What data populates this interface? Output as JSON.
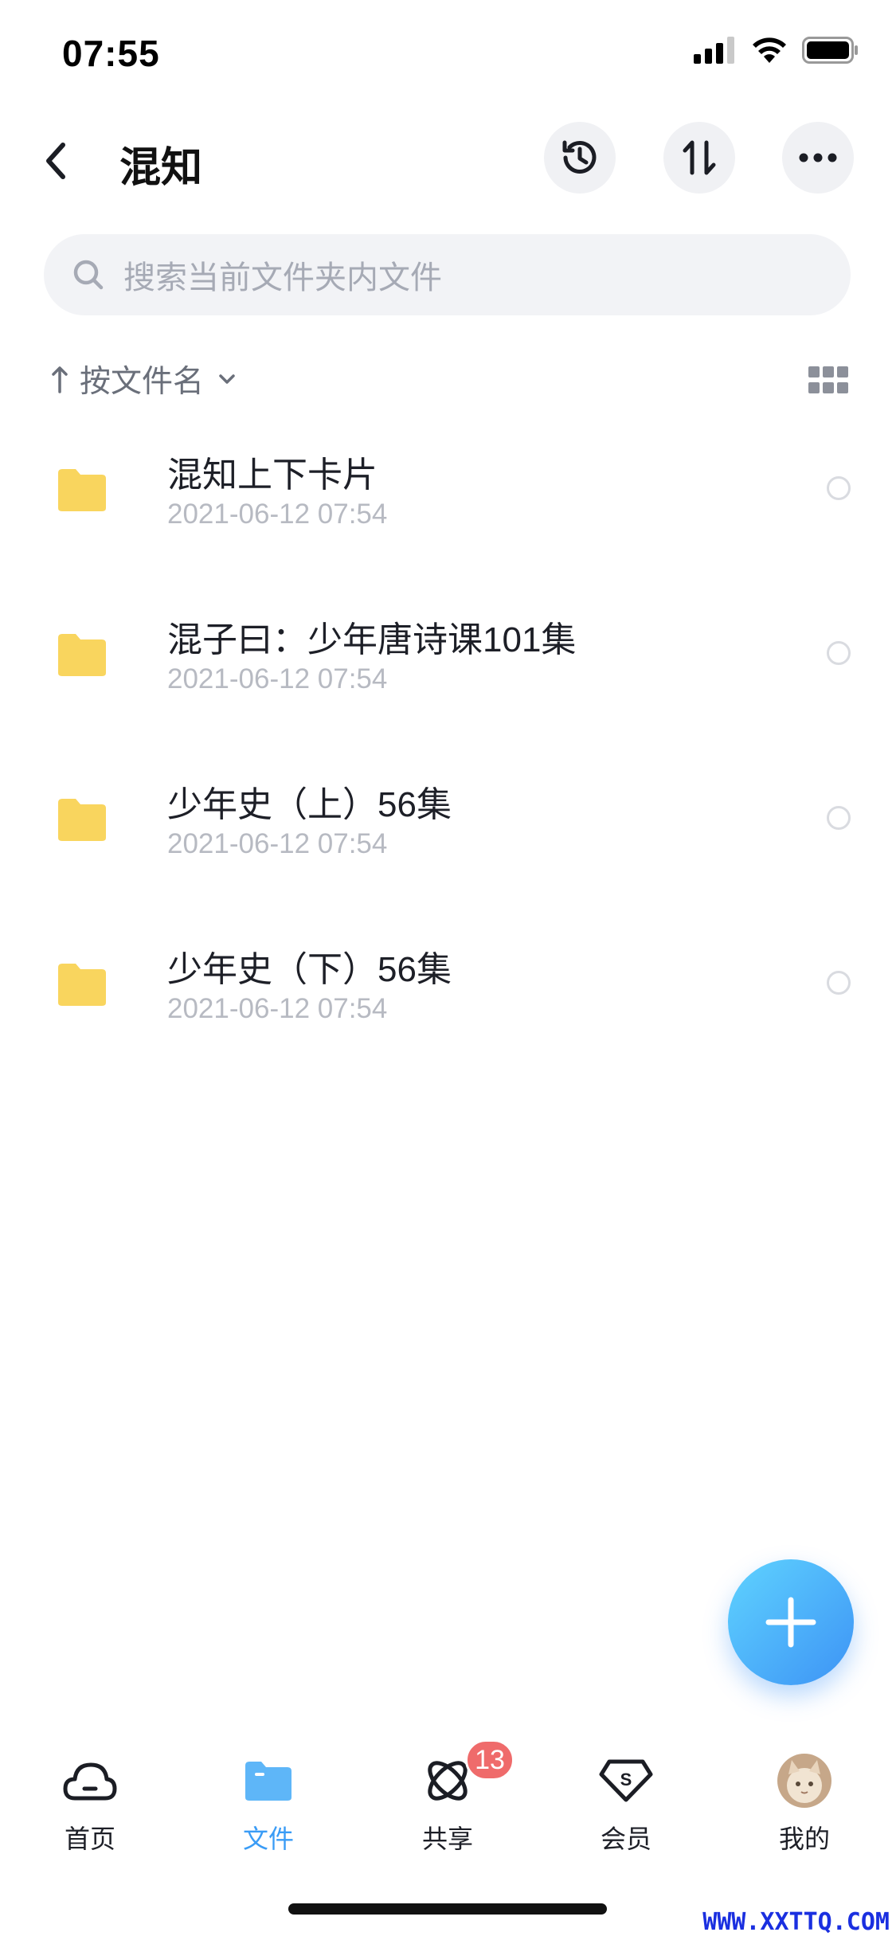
{
  "status_bar": {
    "time": "07:55"
  },
  "header": {
    "title": "混知"
  },
  "search": {
    "placeholder": "搜索当前文件夹内文件"
  },
  "sort": {
    "label": "按文件名"
  },
  "files": [
    {
      "name": "混知上下卡片",
      "date": "2021-06-12 07:54"
    },
    {
      "name": "混子曰：少年唐诗课101集",
      "date": "2021-06-12 07:54"
    },
    {
      "name": "少年史（上）56集",
      "date": "2021-06-12 07:54"
    },
    {
      "name": "少年史（下）56集",
      "date": "2021-06-12 07:54"
    }
  ],
  "tabs": [
    {
      "label": "首页",
      "icon": "cloud-icon"
    },
    {
      "label": "文件",
      "icon": "folder-icon",
      "active": true
    },
    {
      "label": "共享",
      "icon": "share-orbit-icon",
      "badge": "13"
    },
    {
      "label": "会员",
      "icon": "vip-diamond-icon"
    },
    {
      "label": "我的",
      "icon": "avatar"
    }
  ],
  "colors": {
    "accent": "#3a9cf6",
    "folder": "#f9d55e",
    "badge": "#ef6b6b"
  },
  "watermark": "WWW.XXTTQ.COM"
}
